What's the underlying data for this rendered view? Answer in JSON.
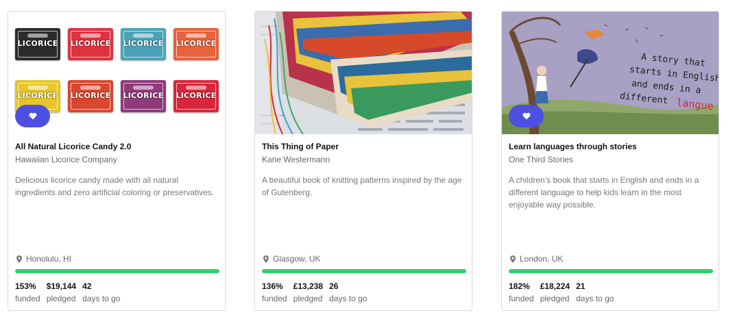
{
  "cards": [
    {
      "title": "All Natural Licorice Candy 2.0",
      "creator": "Hawaiian Licorice Company",
      "blurb": "Delicious licorice candy made with all natural ingredients and zero artificial coloring or preservatives.",
      "location": "Honolulu, HI",
      "funded_pct": "153%",
      "funded_label": "funded",
      "pledged": "$19,144",
      "pledged_label": "pledged",
      "days": "42",
      "days_label": "days to go",
      "progress": 1.0,
      "image_text": "LICORICE"
    },
    {
      "title": "This Thing of Paper",
      "creator": "Karie Westermann",
      "blurb": "A beautiful book of knitting patterns inspired by the age of Gutenberg.",
      "location": "Glasgow, UK",
      "funded_pct": "136%",
      "funded_label": "funded",
      "pledged": "£13,238",
      "pledged_label": "pledged",
      "days": "26",
      "days_label": "days to go",
      "progress": 1.0
    },
    {
      "title": "Learn languages through stories",
      "creator": "One Third Stories",
      "blurb": "A children’s book that starts in English and ends in a different language to help kids learn in the most enjoyable way possible.",
      "location": "London, UK",
      "funded_pct": "182%",
      "funded_label": "funded",
      "pledged": "£18,224",
      "pledged_label": "pledged",
      "days": "21",
      "days_label": "days to go",
      "progress": 1.0,
      "image_text_lines": [
        "A story that",
        "starts in English",
        "and ends in a",
        "different"
      ],
      "image_text_accent": "langue"
    }
  ],
  "colors": {
    "accent": "#4d4fe0",
    "progress": "#2bd16a",
    "licorice_boxes": [
      "#2b2b2b",
      "#e0323f",
      "#4aa3b8",
      "#e8623c",
      "#e6c62a",
      "#d9472e",
      "#8f3a7a",
      "#d8263a"
    ]
  },
  "icons": {
    "favorite": "heart-icon",
    "location": "map-pin-icon"
  }
}
